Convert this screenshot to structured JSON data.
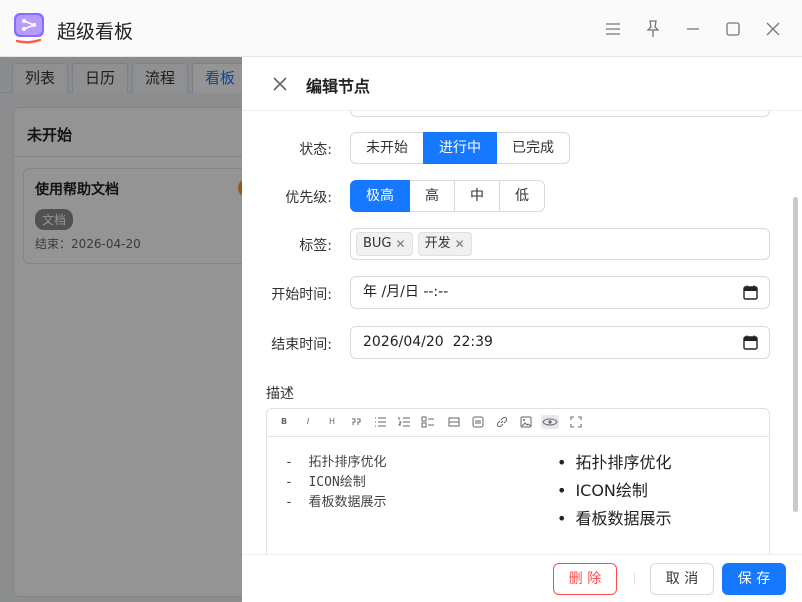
{
  "window": {
    "title": "超级看板",
    "controls": [
      "menu-icon",
      "pin-icon",
      "minimize-icon",
      "maximize-icon",
      "close-icon"
    ]
  },
  "background": {
    "tabs": [
      "列表",
      "日历",
      "流程",
      "看板"
    ],
    "active_tab": "看板",
    "column_title": "未开始",
    "card": {
      "title": "使用帮助文档",
      "tag": "文档",
      "date": "结束：2026-04-20"
    }
  },
  "drawer": {
    "title": "编辑节点",
    "status": {
      "label": "状态:",
      "options": [
        "未开始",
        "进行中",
        "已完成"
      ],
      "selected": "进行中"
    },
    "priority": {
      "label": "优先级:",
      "options": [
        "极高",
        "高",
        "中",
        "低"
      ],
      "selected": "极高"
    },
    "tags": {
      "label": "标签:",
      "items": [
        "BUG",
        "开发"
      ]
    },
    "start_time": {
      "label": "开始时间:",
      "value": "年 /月/日 --:--"
    },
    "end_time": {
      "label": "结束时间:",
      "value": "2026/04/20  22:39"
    },
    "description": {
      "label": "描述",
      "toolbar": [
        "B",
        "I",
        "H",
        "quote-icon",
        "bullet-list-icon",
        "ordered-list-icon",
        "task-list-icon",
        "table-icon",
        "code-icon",
        "link-icon",
        "image-icon",
        "preview-icon",
        "fullscreen-icon"
      ],
      "source_lines": [
        "-  拓扑排序优化",
        "-  ICON绘制",
        "-  看板数据展示"
      ],
      "preview_items": [
        "拓扑排序优化",
        "ICON绘制",
        "看板数据展示"
      ]
    },
    "footer": {
      "delete": "删 除",
      "cancel": "取 消",
      "save": "保 存"
    }
  },
  "colors": {
    "primary": "#1677ff",
    "danger": "#ff4d4f",
    "dim_overlay": "rgba(0,0,0,0.42)"
  }
}
